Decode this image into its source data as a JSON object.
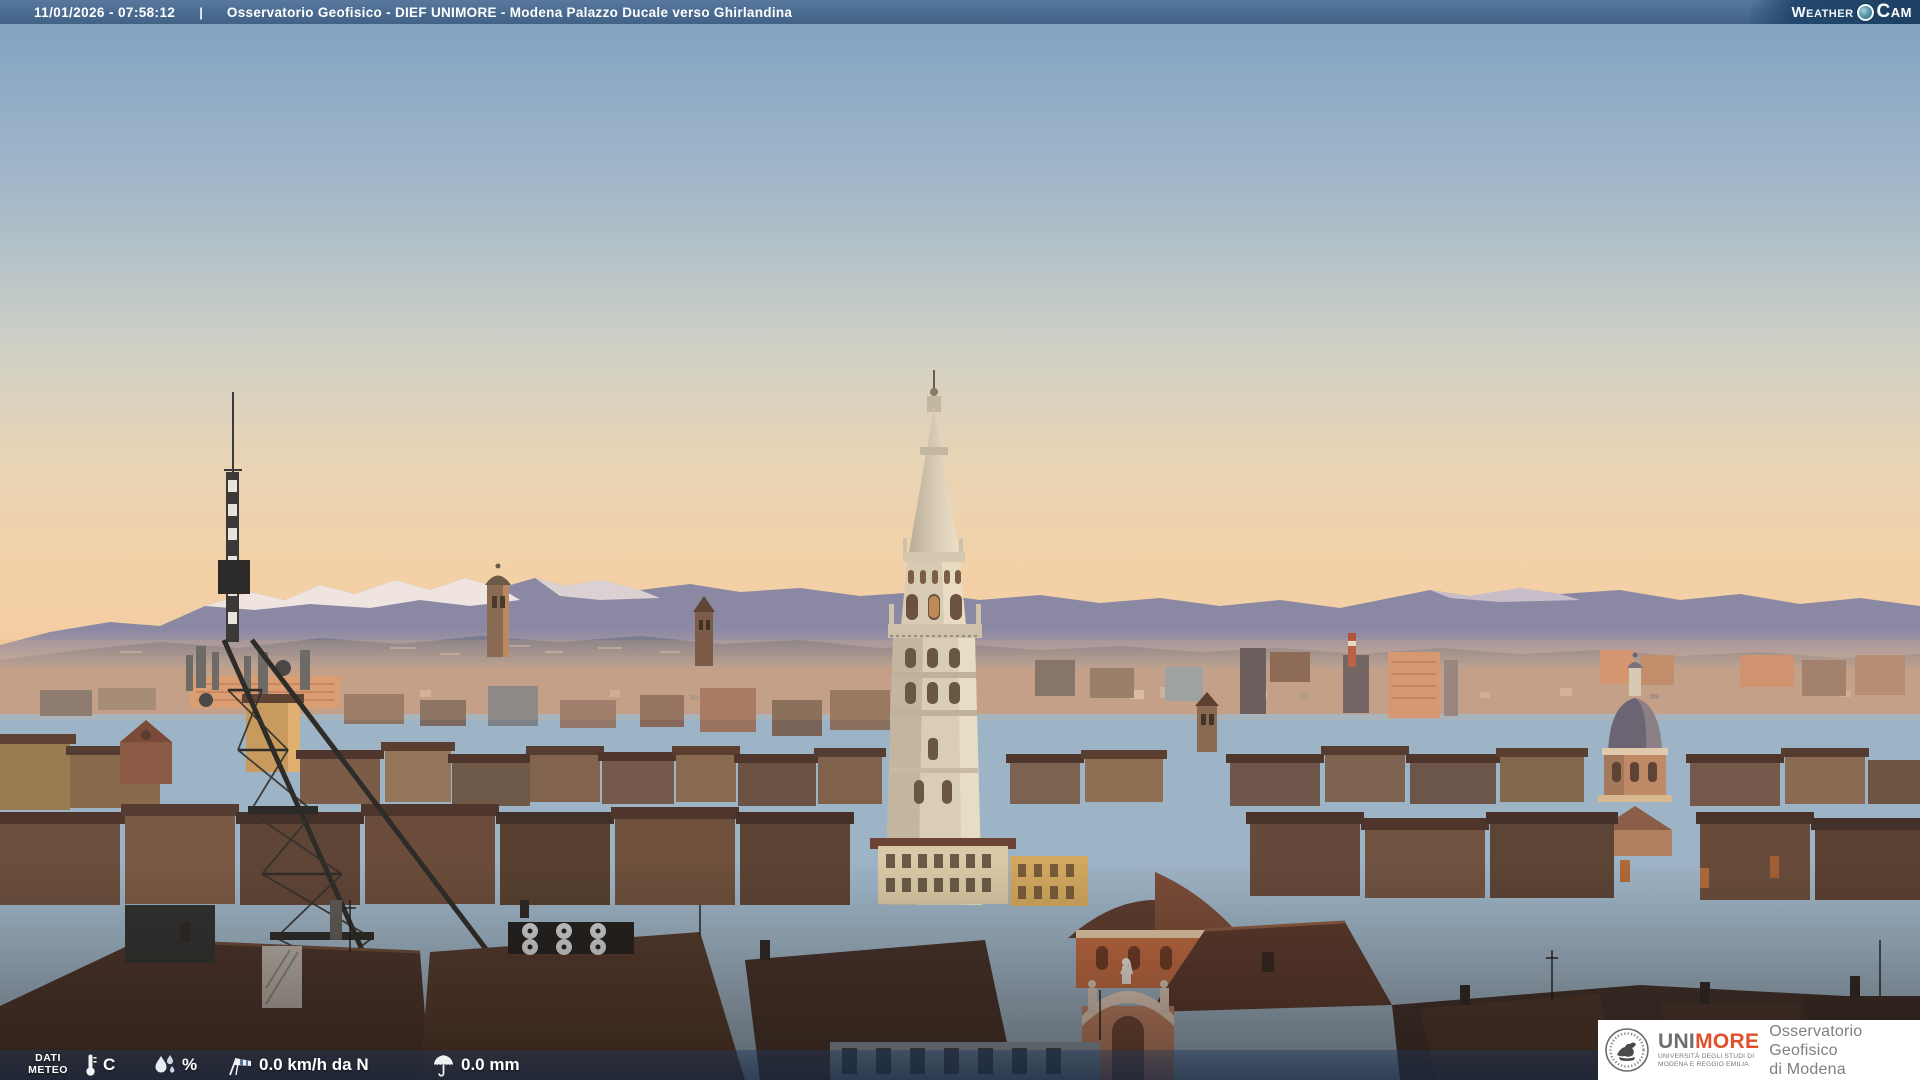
{
  "top_bar": {
    "timestamp": "11/01/2026 - 07:58:12",
    "separator": "|",
    "title": "Osservatorio Geofisico - DIEF UNIMORE - Modena Palazzo Ducale verso Ghirlandina",
    "logo": {
      "word1": "Weather",
      "word2": "Cam"
    }
  },
  "bottom_bar": {
    "label": {
      "line1": "DATI",
      "line2": "METEO"
    },
    "temperature": {
      "text": "C"
    },
    "humidity": {
      "text": "%"
    },
    "wind": {
      "text": "0.0 km/h da N"
    },
    "rain": {
      "text": "0.0 mm"
    }
  },
  "branding": {
    "university": {
      "name_gray": "UNI",
      "name_red": "MORE",
      "subtitle_line1": "UNIVERSITÀ DEGLI STUDI DI",
      "subtitle_line2": "MODENA E REGGIO EMILIA"
    },
    "observatory": {
      "line1": "Osservatorio Geofisico",
      "line2": "di Modena"
    }
  },
  "scene": {
    "description": "Dawn webcam view over Modena rooftops toward the Ghirlandina tower, Apennine mountains with snow on the horizon",
    "landmarks": [
      "ghirlandina-tower",
      "telecom-antenna-mast",
      "church-dome",
      "snowy-mountains"
    ]
  },
  "colors": {
    "top_bar": "#4a6b90",
    "logo_chip": "#1d3f64",
    "bottom_bar_overlay": "rgba(22,42,72,0.62)",
    "unimore_red": "#e0502a",
    "sky_top": "#7ea0c2",
    "sky_horizon": "#f3cba1",
    "text": "#ffffff"
  }
}
